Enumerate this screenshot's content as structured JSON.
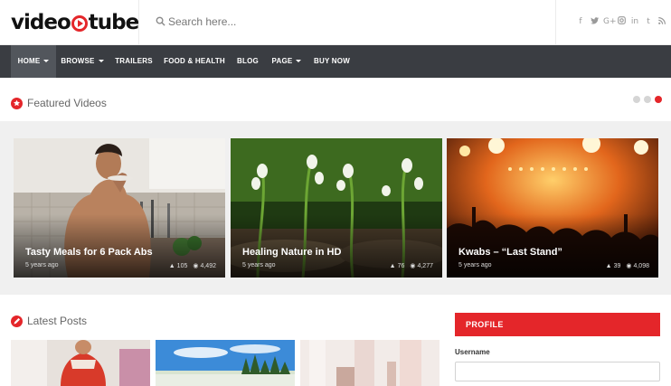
{
  "header": {
    "logo_left": "video",
    "logo_right": "tube",
    "search_placeholder": "Search here...",
    "social_icons": [
      "facebook-icon",
      "twitter-icon",
      "google-plus-icon",
      "instagram-icon",
      "linkedin-icon",
      "tumblr-icon",
      "rss-icon"
    ],
    "social_glyphs": [
      "f",
      "t",
      "G+",
      "◎",
      "in",
      "t",
      "⌁"
    ]
  },
  "nav": {
    "items": [
      {
        "label": "HOME",
        "dropdown": true,
        "active": true
      },
      {
        "label": "BROWSE",
        "dropdown": true,
        "active": false
      },
      {
        "label": "TRAILERS",
        "dropdown": false,
        "active": false
      },
      {
        "label": "FOOD & HEALTH",
        "dropdown": false,
        "active": false
      },
      {
        "label": "BLOG",
        "dropdown": false,
        "active": false
      },
      {
        "label": "PAGE",
        "dropdown": true,
        "active": false
      },
      {
        "label": "BUY NOW",
        "dropdown": false,
        "active": false
      }
    ]
  },
  "featured": {
    "title": "Featured Videos",
    "slider_dots": 3,
    "active_dot": 3,
    "cards": [
      {
        "title": "Tasty Meals for 6 Pack Abs",
        "age": "5 years ago",
        "likes": "105",
        "views": "4,492"
      },
      {
        "title": "Healing Nature in HD",
        "age": "5 years ago",
        "likes": "76",
        "views": "4,277"
      },
      {
        "title": "Kwabs – “Last Stand”",
        "age": "5 years ago",
        "likes": "39",
        "views": "4,098"
      }
    ]
  },
  "latest": {
    "title": "Latest Posts"
  },
  "profile": {
    "heading": "PROFILE",
    "username_label": "Username"
  },
  "colors": {
    "accent": "#e4262a",
    "nav_bg": "#3a3d42",
    "nav_active_bg": "#52565c"
  }
}
